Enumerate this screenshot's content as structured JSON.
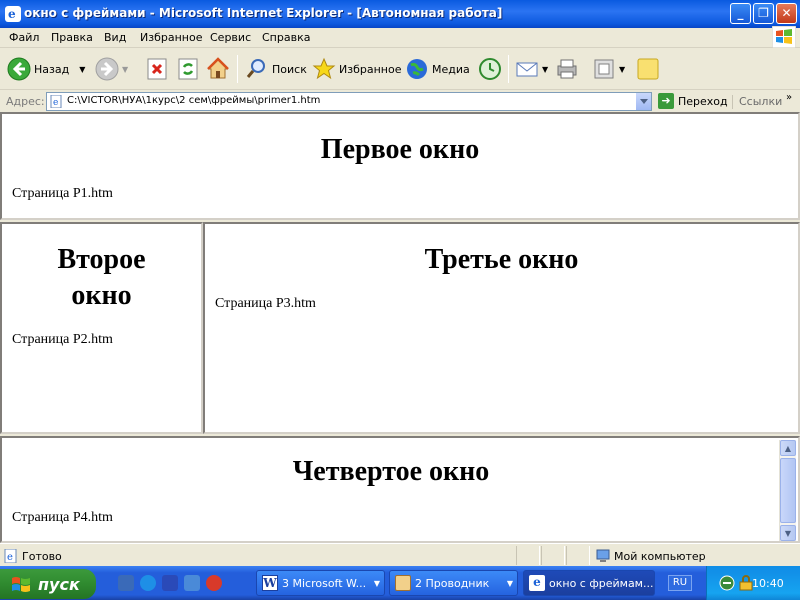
{
  "window": {
    "title": "окно с фреймами - Microsoft Internet Explorer - [Автономная работа]",
    "controls": {
      "minimize": "_",
      "maximize": "❐",
      "close": "✕"
    }
  },
  "menu": [
    "Файл",
    "Правка",
    "Вид",
    "Избранное",
    "Сервис",
    "Справка"
  ],
  "toolbar": {
    "back": "Назад",
    "search": "Поиск",
    "favorites": "Избранное",
    "media": "Медиа"
  },
  "address": {
    "label": "Адрес:",
    "value": "C:\\VICTOR\\НУА\\1курс\\2 сем\\фреймы\\primer1.htm",
    "go": "Переход",
    "links": "Ссылки",
    "more": "»"
  },
  "frames": [
    {
      "heading": "Первое окно",
      "text": "Страница P1.htm"
    },
    {
      "heading": "Второе окно",
      "text": "Страница P2.htm"
    },
    {
      "heading": "Третье окно",
      "text": "Страница P3.htm"
    },
    {
      "heading": "Четвертое окно",
      "text": "Страница P4.htm"
    }
  ],
  "status": {
    "text": "Готово",
    "zone": "Мой компьютер"
  },
  "taskbar": {
    "start": "пуск",
    "tasks": [
      {
        "label": "3 Microsoft W..."
      },
      {
        "label": "2 Проводник"
      },
      {
        "label": "окно с фреймам..."
      }
    ],
    "lang": "RU",
    "clock": "10:40"
  },
  "colors": {
    "titlebar": "#0a5ae0",
    "chrome": "#ece9d8",
    "taskbar": "#245edb",
    "start": "#2f8a2f"
  }
}
